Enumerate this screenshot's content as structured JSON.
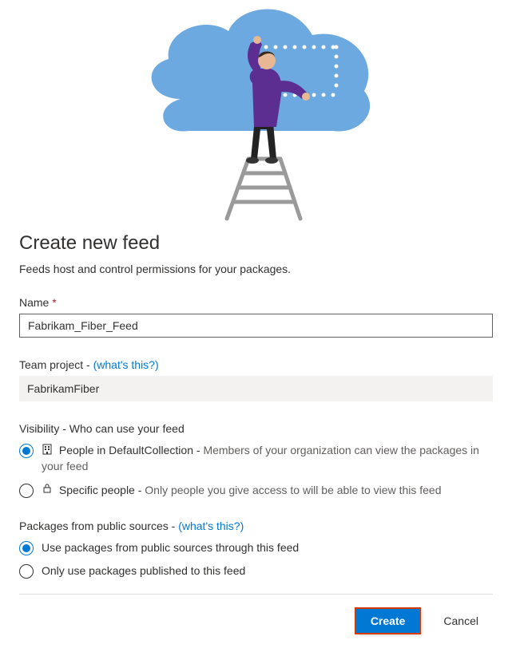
{
  "title": "Create new feed",
  "subtitle": "Feeds host and control permissions for your packages.",
  "name": {
    "label": "Name",
    "value": "Fabrikam_Fiber_Feed"
  },
  "team_project": {
    "label": "Team project - ",
    "help_link": "(what's this?)",
    "value": "FabrikamFiber"
  },
  "visibility": {
    "label": "Visibility - Who can use your feed",
    "options": {
      "collection": {
        "strong": "People in DefaultCollection - ",
        "desc": "Members of your organization can view the packages in your feed"
      },
      "specific": {
        "strong": "Specific people - ",
        "desc": "Only people you give access to will be able to view this feed"
      }
    }
  },
  "packages_section": {
    "label": "Packages from public sources - ",
    "help_link": "(what's this?)",
    "options": {
      "use_public": "Use packages from public sources through this feed",
      "only_published": "Only use packages published to this feed"
    }
  },
  "buttons": {
    "create": "Create",
    "cancel": "Cancel"
  }
}
